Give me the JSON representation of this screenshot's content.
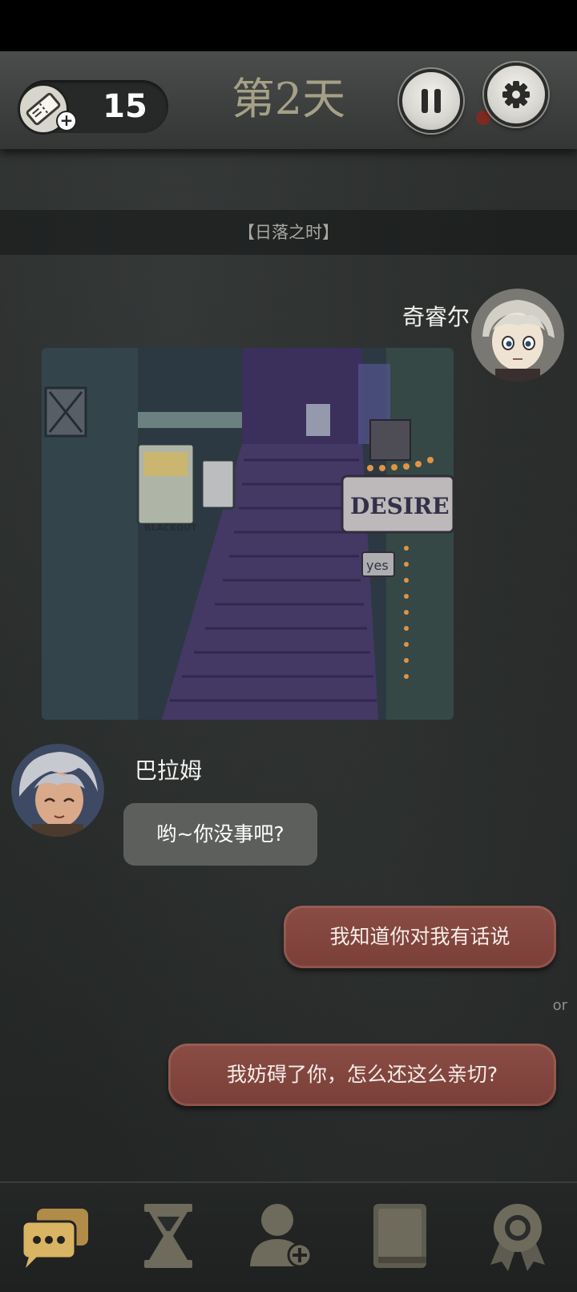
{
  "header": {
    "ticket_count": "15",
    "day_title": "第2天"
  },
  "chapter_banner": "【日落之时】",
  "messages": [
    {
      "speaker": "奇睿尔",
      "type": "image"
    },
    {
      "speaker": "巴拉姆",
      "text": "哟~你没事吧?"
    }
  ],
  "choices": {
    "option_1": "我知道你对我有话说",
    "separator": "or",
    "option_2": "我妨碍了你，怎么还这么亲切?"
  },
  "scene_image": {
    "signs": [
      "BLACKOUT",
      "DESIRE",
      "yes"
    ]
  },
  "icons": {
    "ticket": "ticket-icon",
    "pause": "pause-icon",
    "settings": "gear-icon",
    "nav": [
      "chat-icon",
      "hourglass-icon",
      "add-user-icon",
      "book-icon",
      "award-icon"
    ]
  },
  "colors": {
    "accent_gold": "#c9a85c",
    "choice_red": "#824740",
    "inactive_icon": "#6e6a5c"
  }
}
